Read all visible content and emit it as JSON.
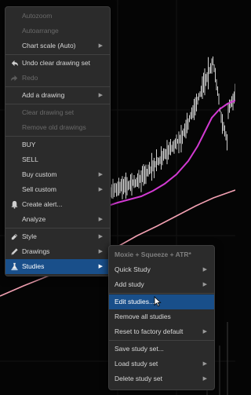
{
  "context_menu": {
    "items": [
      {
        "label": "Autozoom",
        "state": "disabled"
      },
      {
        "label": "Autoarrange",
        "state": "disabled"
      },
      {
        "label": "Chart scale (Auto)",
        "state": "enabled",
        "submenu": true
      },
      {
        "label": "Undo clear drawing set",
        "state": "enabled",
        "icon": "undo-icon"
      },
      {
        "label": "Redo",
        "state": "disabled",
        "icon": "redo-icon"
      },
      {
        "label": "Add a drawing",
        "state": "enabled",
        "submenu": true
      },
      {
        "label": "Clear drawing set",
        "state": "disabled"
      },
      {
        "label": "Remove old drawings",
        "state": "disabled"
      },
      {
        "label": "BUY",
        "state": "enabled"
      },
      {
        "label": "SELL",
        "state": "enabled"
      },
      {
        "label": "Buy custom",
        "state": "enabled",
        "submenu": true
      },
      {
        "label": "Sell custom",
        "state": "enabled",
        "submenu": true
      },
      {
        "label": "Create alert...",
        "state": "enabled",
        "icon": "bell-icon"
      },
      {
        "label": "Analyze",
        "state": "enabled",
        "submenu": true
      },
      {
        "label": "Style",
        "state": "enabled",
        "submenu": true,
        "icon": "style-icon"
      },
      {
        "label": "Drawings",
        "state": "enabled",
        "submenu": true,
        "icon": "pencil-icon"
      },
      {
        "label": "Studies",
        "state": "highlighted",
        "submenu": true,
        "icon": "flask-icon"
      }
    ]
  },
  "studies_submenu": {
    "header": "Moxie + Squeeze + ATR*",
    "items": [
      {
        "label": "Quick Study",
        "state": "enabled",
        "submenu": true
      },
      {
        "label": "Add study",
        "state": "enabled",
        "submenu": true
      },
      {
        "label": "Edit studies...",
        "state": "highlighted"
      },
      {
        "label": "Remove all studies",
        "state": "enabled"
      },
      {
        "label": "Reset to factory default",
        "state": "enabled",
        "submenu": true
      },
      {
        "label": "Save study set...",
        "state": "enabled"
      },
      {
        "label": "Load study set",
        "state": "enabled",
        "submenu": true
      },
      {
        "label": "Delete study set",
        "state": "enabled",
        "submenu": true
      }
    ]
  },
  "colors": {
    "chart_background": "#050505",
    "price_bars": "#cfcfcf",
    "magenta_study_line": "#d23ad2",
    "pink_study_line": "#f2a0b2",
    "menu_background": "#2b2b2b",
    "highlight": "#194f8a",
    "disabled_text": "#6a6a6a"
  }
}
